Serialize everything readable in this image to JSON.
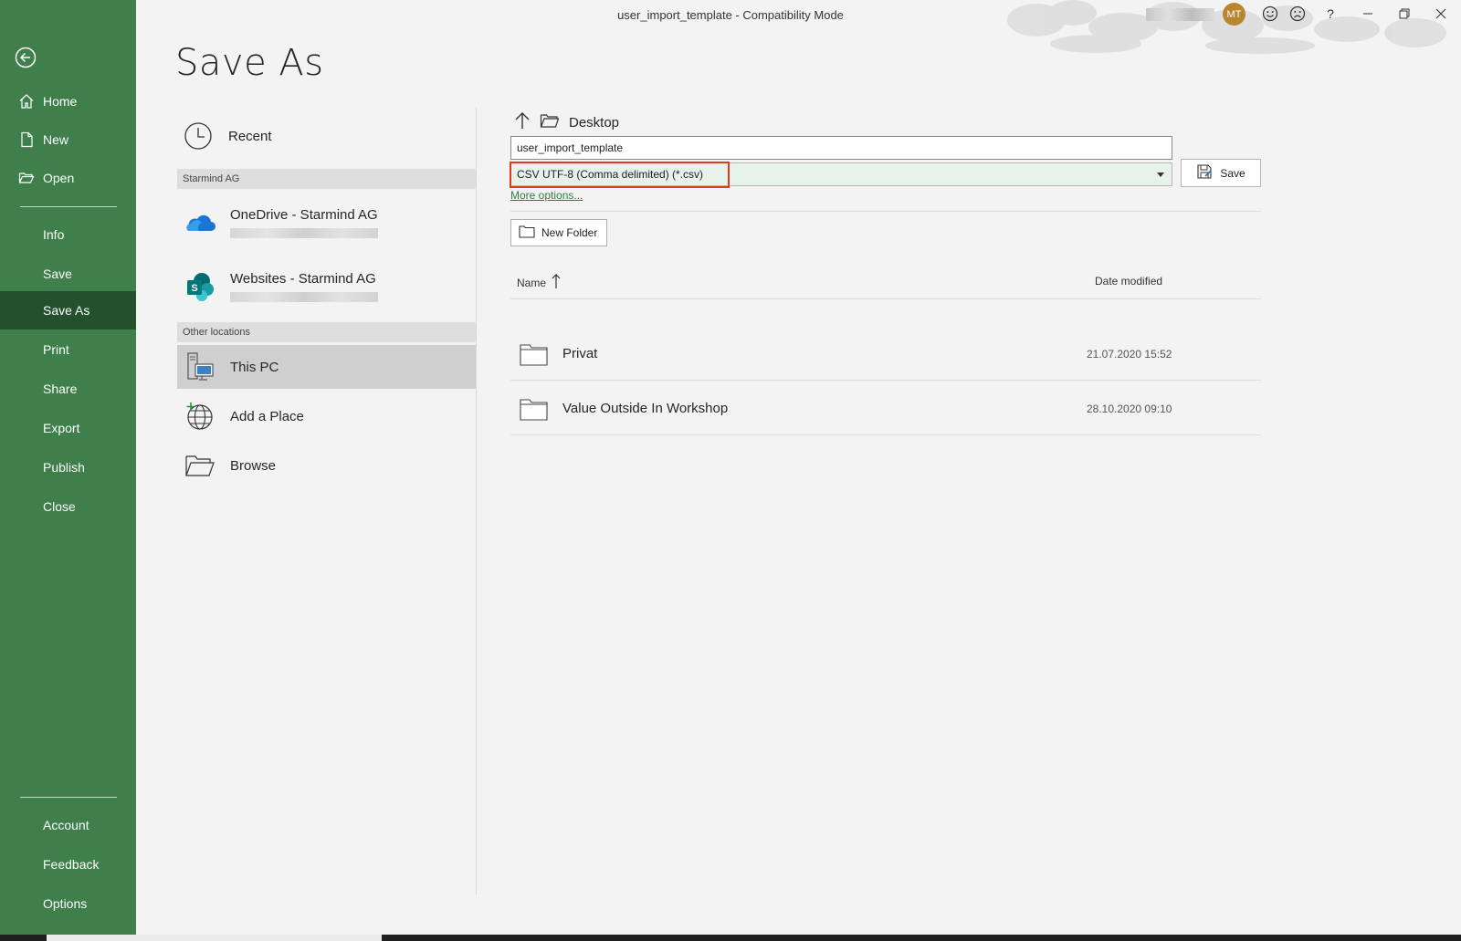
{
  "window": {
    "title": "user_import_template  -  Compatibility Mode",
    "avatar_initials": "MT",
    "help_label": "?"
  },
  "nav": {
    "items": [
      {
        "label": "Home",
        "icon": "home-icon"
      },
      {
        "label": "New",
        "icon": "new-document-icon"
      },
      {
        "label": "Open",
        "icon": "open-folder-icon"
      },
      {
        "label": "Info"
      },
      {
        "label": "Save"
      },
      {
        "label": "Save As",
        "active": true
      },
      {
        "label": "Print"
      },
      {
        "label": "Share"
      },
      {
        "label": "Export"
      },
      {
        "label": "Publish"
      },
      {
        "label": "Close"
      }
    ],
    "bottom_items": [
      {
        "label": "Account"
      },
      {
        "label": "Feedback"
      },
      {
        "label": "Options"
      }
    ]
  },
  "page_title": "Save As",
  "locations": {
    "recent": "Recent",
    "group_starmind": "Starmind AG",
    "onedrive": "OneDrive - Starmind AG",
    "websites": "Websites - Starmind AG",
    "group_other": "Other locations",
    "this_pc": "This PC",
    "add_place": "Add a Place",
    "browse": "Browse"
  },
  "save_panel": {
    "current_folder": "Desktop",
    "filename": "user_import_template",
    "filetype": "CSV UTF-8 (Comma delimited) (*.csv)",
    "save_label": "Save",
    "more_options": "More options...",
    "new_folder": "New Folder",
    "col_name": "Name",
    "col_date": "Date modified",
    "files": [
      {
        "name": "Privat",
        "date": "21.07.2020 15:52"
      },
      {
        "name": "Value Outside In Workshop",
        "date": "28.10.2020 09:10"
      }
    ]
  },
  "colors": {
    "nav_bg": "#3f7f4c",
    "nav_active": "#24512d",
    "highlight_box": "#e03a1e",
    "link": "#2e7d42",
    "avatar": "#b8862f"
  }
}
